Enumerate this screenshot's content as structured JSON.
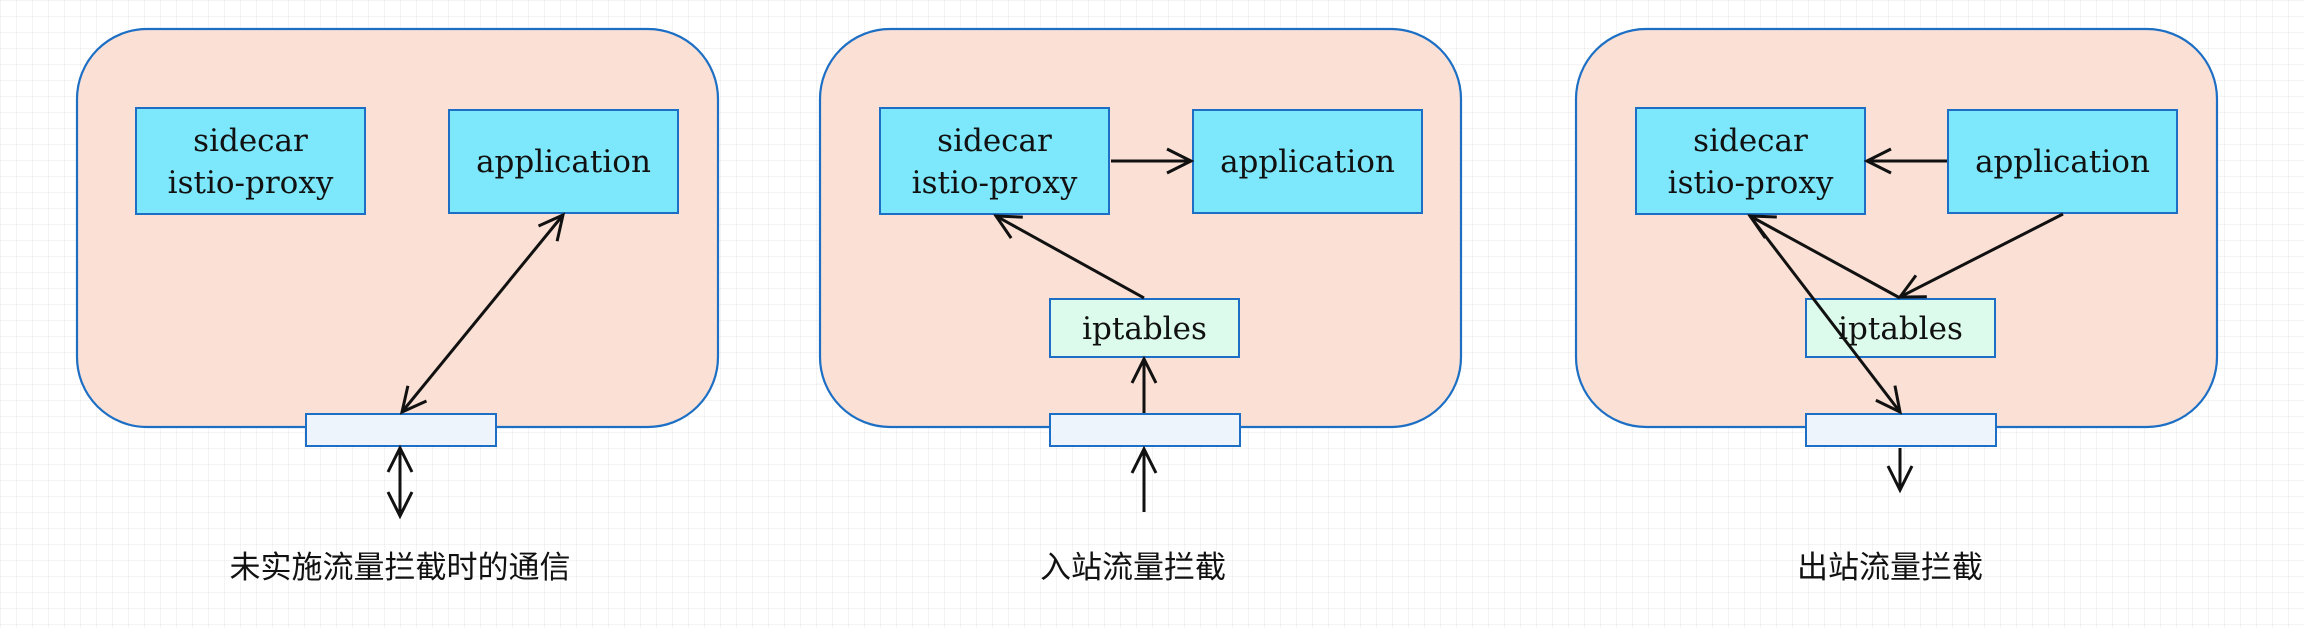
{
  "panels": [
    {
      "sidecar_line1": "sidecar",
      "sidecar_line2": "istio-proxy",
      "application": "application",
      "caption": "未实施流量拦截时的通信"
    },
    {
      "sidecar_line1": "sidecar",
      "sidecar_line2": "istio-proxy",
      "application": "application",
      "iptables": "iptables",
      "caption": "入站流量拦截"
    },
    {
      "sidecar_line1": "sidecar",
      "sidecar_line2": "istio-proxy",
      "application": "application",
      "iptables": "iptables",
      "caption": "出站流量拦截"
    }
  ],
  "colors": {
    "pod_fill": "#fae0d5",
    "border": "#1c6fc4",
    "component_fill": "#7de8fc",
    "iptables_fill": "#dcfbec",
    "port_fill": "#edf4fb",
    "arrow": "#111111"
  }
}
